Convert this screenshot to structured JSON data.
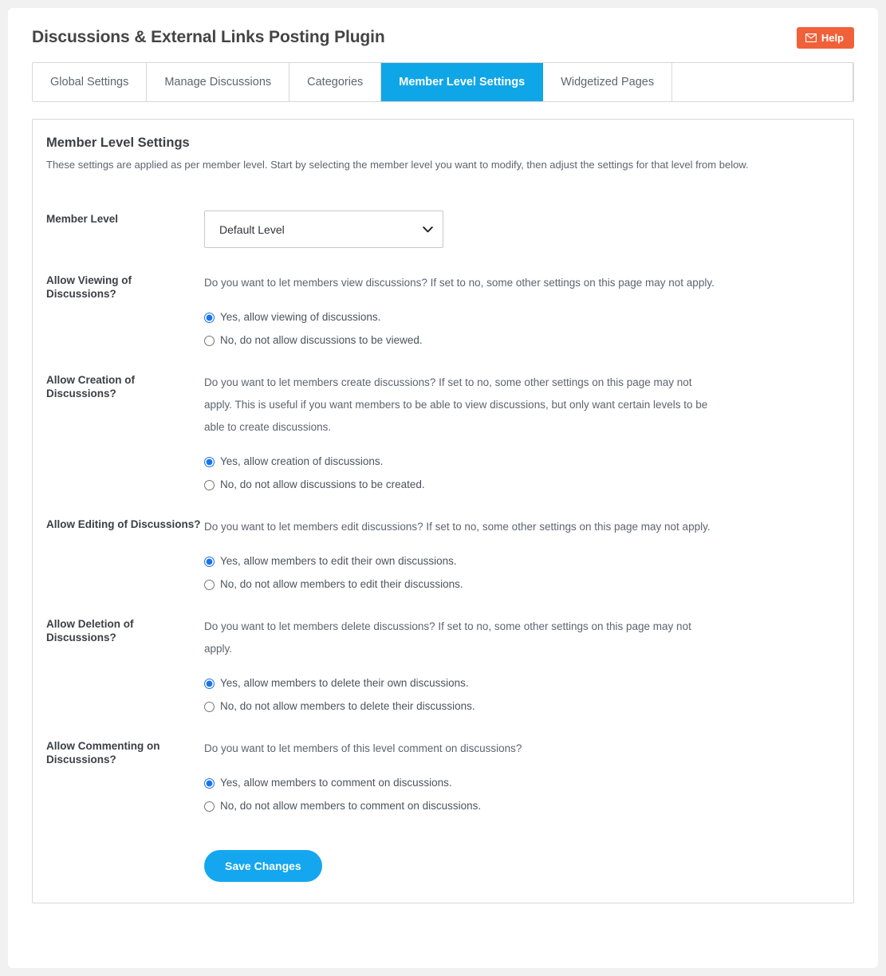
{
  "header": {
    "title": "Discussions & External Links Posting Plugin",
    "help_label": "Help",
    "help_icon": "mail-icon",
    "help_color": "#f0613a"
  },
  "tabs": [
    {
      "label": "Global Settings",
      "active": false
    },
    {
      "label": "Manage Discussions",
      "active": false
    },
    {
      "label": "Categories",
      "active": false
    },
    {
      "label": "Member Level Settings",
      "active": true
    },
    {
      "label": "Widgetized Pages",
      "active": false
    }
  ],
  "tab_active_color": "#0fa6e8",
  "panel": {
    "title": "Member Level Settings",
    "description": "These settings are applied as per member level. Start by selecting the member level you want to modify, then adjust the settings for that level from below."
  },
  "member_level": {
    "label": "Member Level",
    "selected": "Default Level",
    "options": [
      "Default Level"
    ],
    "chevron_icon": "chevron-down-icon"
  },
  "settings": [
    {
      "label": "Allow Viewing of Discussions?",
      "description": "Do you want to let members view discussions? If set to no, some other settings on this page may not apply.",
      "options": [
        {
          "text": "Yes, allow viewing of discussions.",
          "checked": true
        },
        {
          "text": "No, do not allow discussions to be viewed.",
          "checked": false
        }
      ]
    },
    {
      "label": "Allow Creation of Discussions?",
      "description": "Do you want to let members create discussions? If set to no, some other settings on this page may not apply. This is useful if you want members to be able to view discussions, but only want certain levels to be able to create discussions.",
      "options": [
        {
          "text": "Yes, allow creation of discussions.",
          "checked": true
        },
        {
          "text": "No, do not allow discussions to be created.",
          "checked": false
        }
      ]
    },
    {
      "label": "Allow Editing of Discussions?",
      "description": "Do you want to let members edit discussions? If set to no, some other settings on this page may not apply.",
      "options": [
        {
          "text": "Yes, allow members to edit their own discussions.",
          "checked": true
        },
        {
          "text": "No, do not allow members to edit their discussions.",
          "checked": false
        }
      ]
    },
    {
      "label": "Allow Deletion of Discussions?",
      "description": "Do you want to let members delete discussions? If set to no, some other settings on this page may not apply.",
      "options": [
        {
          "text": "Yes, allow members to delete their own discussions.",
          "checked": true
        },
        {
          "text": "No, do not allow members to delete their discussions.",
          "checked": false
        }
      ]
    },
    {
      "label": "Allow Commenting on Discussions?",
      "description": "Do you want to let members of this level comment on discussions?",
      "options": [
        {
          "text": "Yes, allow members to comment on discussions.",
          "checked": true
        },
        {
          "text": "No, do not allow members to comment on discussions.",
          "checked": false
        }
      ]
    }
  ],
  "save": {
    "label": "Save Changes",
    "color": "#14a7ef"
  }
}
